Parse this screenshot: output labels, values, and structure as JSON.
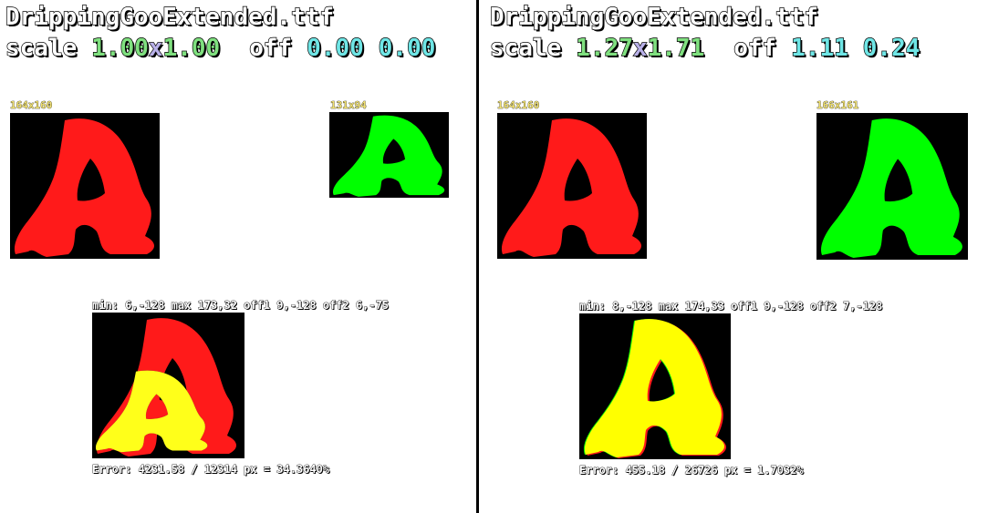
{
  "colors": {
    "background": "#ffffff",
    "canvas": "#000000",
    "glyph_reference": "#ff1a1a",
    "glyph_rendered": "#00ff00",
    "overlap": "#ffff00",
    "label_yellow": "#f0e070",
    "value_green": "#7fe07f",
    "value_cyan": "#6fe6e6"
  },
  "left": {
    "title": "DrippingGooExtended.ttf",
    "scale_label": "scale",
    "scale_x": "1.00",
    "scale_sep": "x",
    "scale_y": "1.00",
    "off_label": "off",
    "off_x": "0.00",
    "off_y": "0.00",
    "ref_size": "164x160",
    "out_size": "131x94",
    "stats": "min: 6,-128  max 173,32  off1 9,-128  off2 6,-75",
    "error": "Error: 4231.58 / 12314 px = 34.3640%"
  },
  "right": {
    "title": "DrippingGooExtended.ttf",
    "scale_label": "scale",
    "scale_x": "1.27",
    "scale_sep": "x",
    "scale_y": "1.71",
    "off_label": "off",
    "off_x": "1.11",
    "off_y": "0.24",
    "ref_size": "164x160",
    "out_size": "166x161",
    "stats": "min: 8,-128  max 174,33  off1 9,-128  off2 7,-128",
    "error": "Error: 455.18 / 26726 px = 1.7032%"
  }
}
